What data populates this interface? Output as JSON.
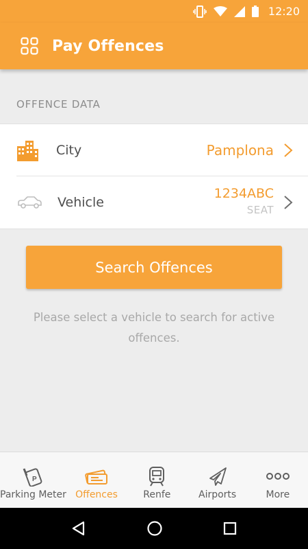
{
  "status_bar": {
    "time": "12:20"
  },
  "app_bar": {
    "title": "Pay Offences",
    "menu_icon": "grid-icon"
  },
  "section": {
    "header": "OFFENCE DATA"
  },
  "city_row": {
    "label": "City",
    "value": "Pamplona",
    "icon": "building-icon"
  },
  "vehicle_row": {
    "label": "Vehicle",
    "plate": "1234ABC",
    "brand": "SEAT",
    "icon": "car-icon"
  },
  "search_button": {
    "label": "Search Offences"
  },
  "helper_text": "Please select a vehicle to search for active offences.",
  "bottom_nav": {
    "items": [
      {
        "label": "Parking Meter",
        "icon": "parking-meter-icon",
        "active": false
      },
      {
        "label": "Offences",
        "icon": "tickets-icon",
        "active": true
      },
      {
        "label": "Renfe",
        "icon": "train-icon",
        "active": false
      },
      {
        "label": "Airports",
        "icon": "airplane-icon",
        "active": false
      },
      {
        "label": "More",
        "icon": "more-icon",
        "active": false
      }
    ]
  },
  "colors": {
    "accent": "#f7a43a",
    "accent_text": "#f39c2f",
    "background": "#ededed"
  }
}
